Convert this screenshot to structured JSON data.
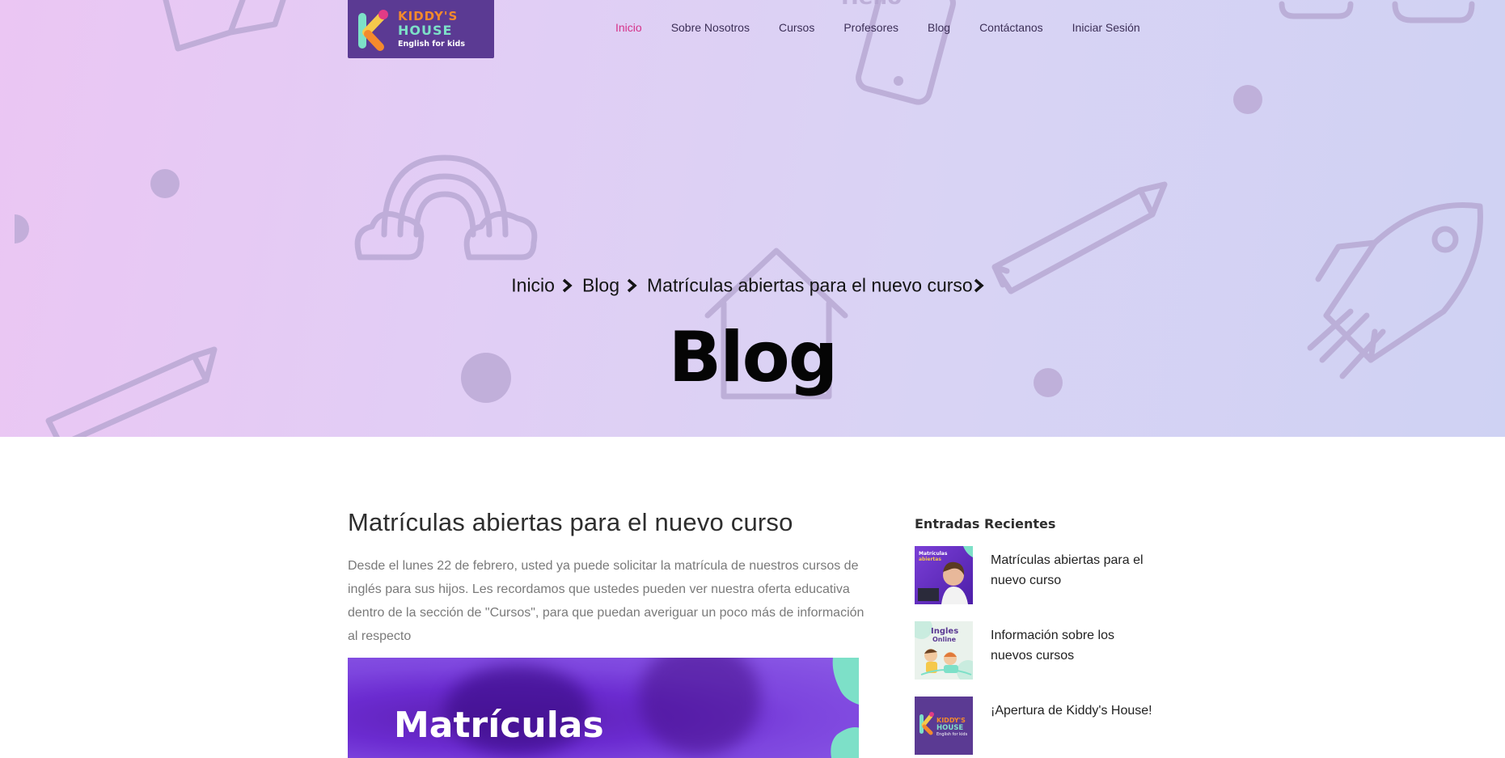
{
  "logo": {
    "line1": "KIDDY'S",
    "line2": "HOUSE",
    "line3": "English for kids"
  },
  "nav": {
    "items": [
      {
        "label": "Inicio",
        "active": true
      },
      {
        "label": "Sobre Nosotros",
        "active": false
      },
      {
        "label": "Cursos",
        "active": false
      },
      {
        "label": "Profesores",
        "active": false
      },
      {
        "label": "Blog",
        "active": false
      },
      {
        "label": "Contáctanos",
        "active": false
      },
      {
        "label": "Iniciar Sesión",
        "active": false
      }
    ]
  },
  "breadcrumb": {
    "items": [
      "Inicio",
      "Blog",
      "Matrículas abiertas para el nuevo curso"
    ]
  },
  "hero": {
    "title": "Blog",
    "background_deco_text": "Hello"
  },
  "post": {
    "title": "Matrículas abiertas para el nuevo curso",
    "body": "Desde el lunes 22 de febrero, usted ya puede solicitar la matrícula de nuestros cursos de inglés para sus hijos. Les recordamos que ustedes pueden ver nuestra oferta educativa dentro de la sección de \"Cursos\", para que puedan averiguar un poco más de información al respecto",
    "image_text": "Matrículas"
  },
  "sidebar": {
    "title": "Entradas Recientes",
    "recent": [
      {
        "title": "Matrículas abiertas para el nuevo curso",
        "thumb_text": "Matrículas abiertas"
      },
      {
        "title": "Información sobre los nuevos cursos",
        "thumb_text": "Ingles Online"
      },
      {
        "title": "¡Apertura de Kiddy's House!",
        "thumb_text": "KIDDY'S HOUSE"
      }
    ]
  },
  "colors": {
    "accent": "#d6338a",
    "logo_bg": "#5b3a93",
    "logo_orange": "#f48a2c",
    "logo_mint": "#7de0c8",
    "nav_text": "#3c2f57"
  }
}
